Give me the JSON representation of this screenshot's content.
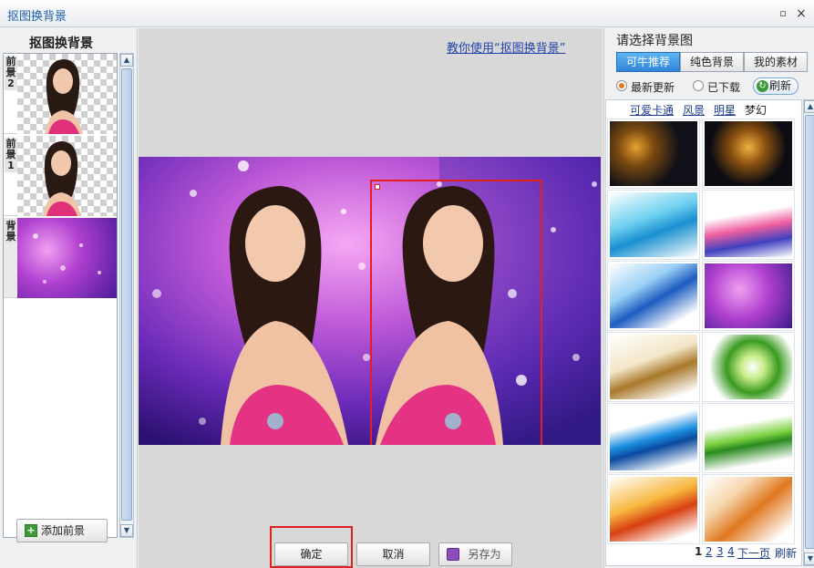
{
  "window": {
    "title": "抠图换背景",
    "restore_glyph": "▫",
    "close_glyph": "×"
  },
  "layers_panel": {
    "heading": "抠图换背景",
    "layers": [
      {
        "label": "前景2",
        "kind": "foreground"
      },
      {
        "label": "前景1",
        "kind": "foreground"
      },
      {
        "label": "背景",
        "kind": "background"
      }
    ],
    "add_button": "添加前景"
  },
  "editor": {
    "help_link": "教你使用“抠图换背景”",
    "confirm_button": "确定",
    "cancel_button": "取消",
    "save_as_button": "另存为"
  },
  "background_picker": {
    "heading": "请选择背景图",
    "tabs": [
      "可牛推荐",
      "纯色背景",
      "我的素材"
    ],
    "active_tab": 0,
    "filters": [
      {
        "label": "最新更新",
        "selected": true
      },
      {
        "label": "已下载",
        "selected": false
      }
    ],
    "refresh_button": "刷新",
    "categories": [
      "可爱卡通",
      "风景",
      "明星",
      "梦幻"
    ],
    "current_category": 3,
    "thumbnails": [
      "bokeh-dark-gold",
      "bokeh-dark-warm",
      "blue-waves",
      "pink-waves",
      "blue-swirl",
      "purple-bokeh",
      "gold-silk",
      "green-orb",
      "blue-ribbon",
      "green-ribbon",
      "orange-flame",
      "orange-silk"
    ],
    "pager": {
      "pages": [
        "1",
        "2",
        "3",
        "4"
      ],
      "current": 0,
      "next": "下一页",
      "refresh": "刷新"
    }
  },
  "colors": {
    "accent": "#2f86d8",
    "highlight": "#e32020",
    "link": "#1b3d8f"
  }
}
